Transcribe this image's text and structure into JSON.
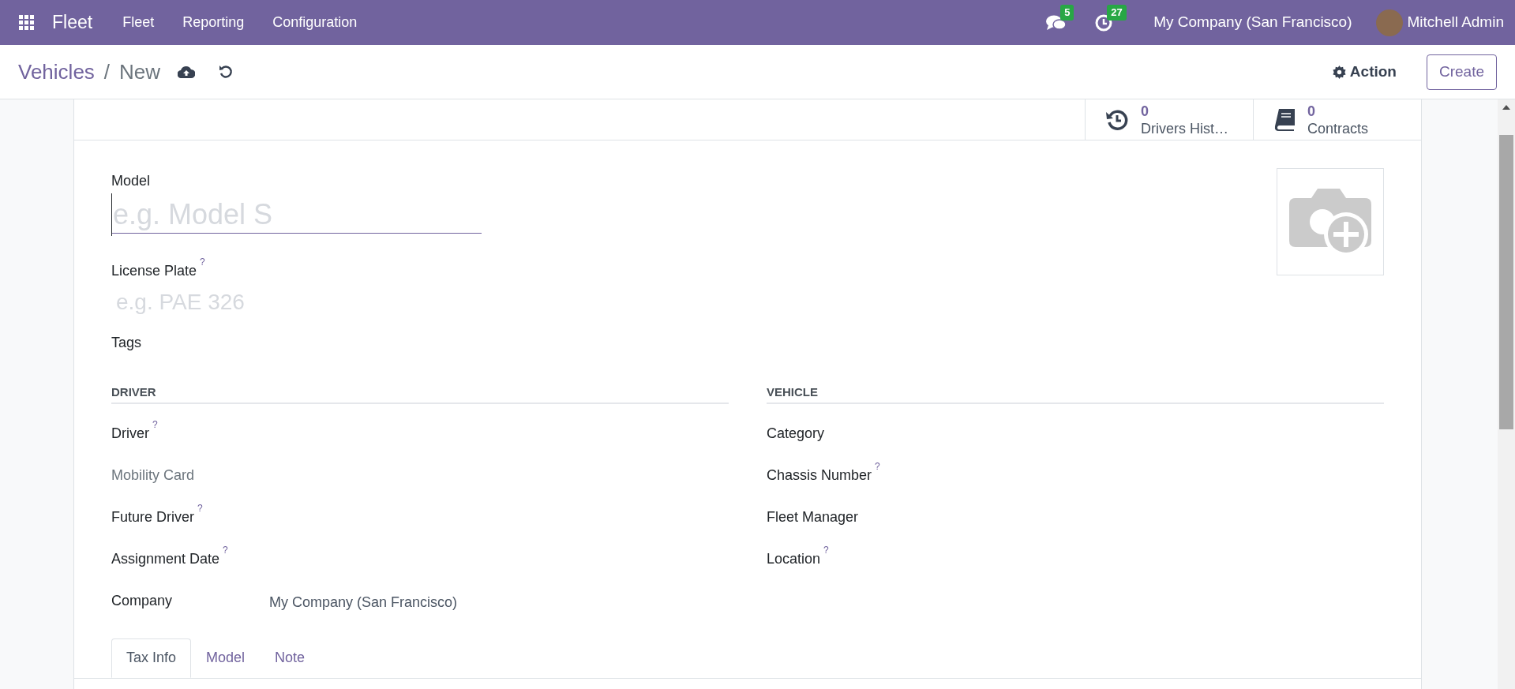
{
  "navbar": {
    "app_name": "Fleet",
    "menu": [
      "Fleet",
      "Reporting",
      "Configuration"
    ],
    "messages_count": "5",
    "activities_count": "27",
    "company": "My Company (San Francisco)",
    "user": "Mitchell Admin"
  },
  "control_panel": {
    "breadcrumb": [
      "Vehicles",
      "New"
    ],
    "breadcrumb_separator": "/",
    "action_label": "Action",
    "create_label": "Create"
  },
  "stat_buttons": [
    {
      "kind": "history",
      "value": "0",
      "label": "Drivers Hist…"
    },
    {
      "kind": "book",
      "value": "0",
      "label": "Contracts"
    }
  ],
  "form": {
    "model": {
      "label": "Model",
      "placeholder": "e.g. Model S"
    },
    "license_plate": {
      "label": "License Plate",
      "help": "?",
      "placeholder": "e.g. PAE 326"
    },
    "tags": {
      "label": "Tags"
    },
    "groups": [
      {
        "title": "DRIVER",
        "fields": [
          {
            "kind": "label",
            "label": "Driver",
            "help": "?"
          },
          {
            "kind": "muted",
            "label": "Mobility Card"
          },
          {
            "kind": "label",
            "label": "Future Driver",
            "help": "?"
          },
          {
            "kind": "label",
            "label": "Assignment Date",
            "help": "?"
          },
          {
            "kind": "label",
            "label": "Company",
            "value": "My Company (San Francisco)"
          }
        ]
      },
      {
        "title": "VEHICLE",
        "fields": [
          {
            "kind": "label",
            "label": "Category"
          },
          {
            "kind": "label",
            "label": "Chassis Number",
            "help": "?"
          },
          {
            "kind": "label",
            "label": "Fleet Manager"
          },
          {
            "kind": "label",
            "label": "Location",
            "help": "?"
          }
        ]
      }
    ],
    "tabs": [
      {
        "label": "Tax Info",
        "selected": true
      },
      {
        "label": "Model",
        "selected": false
      },
      {
        "label": "Note",
        "selected": false
      }
    ]
  }
}
